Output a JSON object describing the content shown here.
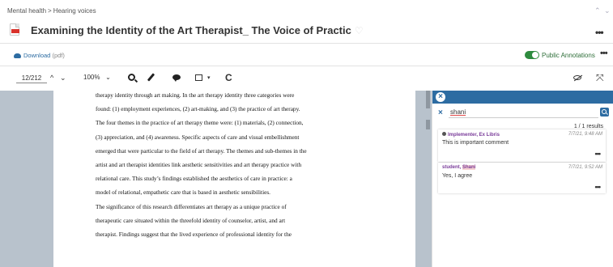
{
  "breadcrumb": {
    "parent": "Mental health",
    "separator": ">",
    "current": "Hearing voices"
  },
  "document": {
    "title": "Examining the Identity of the Art Therapist_ The Voice of Practic"
  },
  "header": {
    "more_label": "•••",
    "chevron_up": "⌃",
    "chevron_down": "⌄"
  },
  "download": {
    "label": "Download",
    "type": "(pdf)"
  },
  "annotations_toggle": {
    "label": "Public Annotations",
    "state": "on"
  },
  "toolbar": {
    "page": "12/212",
    "zoom": "100%",
    "up": "^",
    "down": "⌄",
    "zoom_caret": "⌄",
    "refresh": "C",
    "expand": "⤧",
    "more_label": "•••"
  },
  "pdf_lines": [
    "therapy identity through art making. In the art therapy identity three categories were",
    "found: (1) employment experiences, (2) art-making, and (3) the practice of art therapy.",
    "The four themes in the practice of art therapy theme were: (1) materials, (2) connection,",
    "(3) appreciation, and (4) awareness. Specific aspects of care and visual embellishment",
    "emerged that were particular to the field of art therapy. The themes and sub-themes in the",
    "artist and art therapist identities link aesthetic sensitivities and art therapy practice with",
    "relational care.  This study’s findings established the aesthetics of care in practice: a",
    "model of relational, empathetic care that is based in aesthetic sensibilities.",
    " The significance of this research differentiates art therapy as a unique practice of",
    "therapeutic care situated within the threefold identity of counselor, artist, and art",
    "therapist.  Findings suggest that the lived experience of professional identity for the"
  ],
  "annotation_panel": {
    "close_label": "×",
    "search_clear": "×",
    "search_value": "shani",
    "results": "1 / 1 results",
    "cards": [
      {
        "author": "Implementer, Ex Libris",
        "date": "7/7/21, 9:48 AM",
        "text": "This is important comment",
        "more": "•••"
      },
      {
        "author_prefix": "student, ",
        "author_highlight": "Shani",
        "date": "7/7/21, 9:52 AM",
        "text": "Yes, I agree",
        "more": "•••"
      }
    ]
  },
  "colors": {
    "accent": "#2d6ca2",
    "toggle_on": "#2e8b3e",
    "author": "#7a3c9a",
    "pdf_red": "#d9322b",
    "viewer_bg": "#b8c2cc"
  },
  "icons": [
    "pdf-file-icon",
    "heart-icon",
    "cloud-download-icon",
    "search-icon",
    "pen-icon",
    "comment-icon",
    "rectangle-select-icon",
    "refresh-icon",
    "eye-slash-icon",
    "expand-icon",
    "close-icon",
    "user-icon"
  ]
}
